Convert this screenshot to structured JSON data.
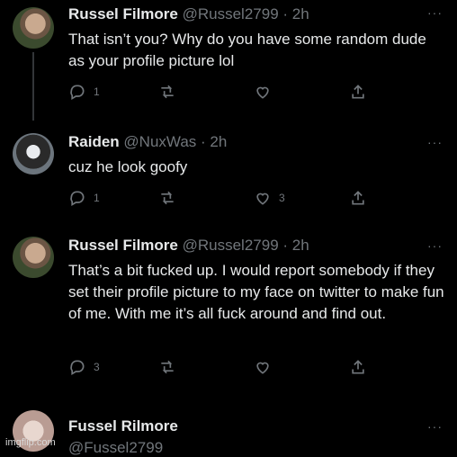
{
  "tweets": [
    {
      "name": "Russel Filmore",
      "handle": "@Russel2799",
      "time": "· 2h",
      "text": "That isn’t you? Why do you have some random dude as your profile picture lol",
      "replies": "1",
      "retweets": "",
      "likes": ""
    },
    {
      "name": "Raiden",
      "handle": "@NuxWas",
      "time": "· 2h",
      "text": "cuz he look goofy",
      "replies": "1",
      "retweets": "",
      "likes": "3"
    },
    {
      "name": "Russel Filmore",
      "handle": "@Russel2799",
      "time": "· 2h",
      "text": "That’s a bit fucked up. I would report somebody if they set their profile picture to my face on twitter to make fun of me. With me it’s all fuck around and find out.",
      "replies": "3",
      "retweets": "",
      "likes": ""
    },
    {
      "name": "Fussel Rilmore",
      "handle": "@Fussel2799"
    }
  ],
  "ui": {
    "more_label": "···",
    "watermark": "imgflip.com"
  },
  "icons": [
    "reply-icon",
    "retweet-icon",
    "like-icon",
    "share-icon",
    "more-icon"
  ]
}
